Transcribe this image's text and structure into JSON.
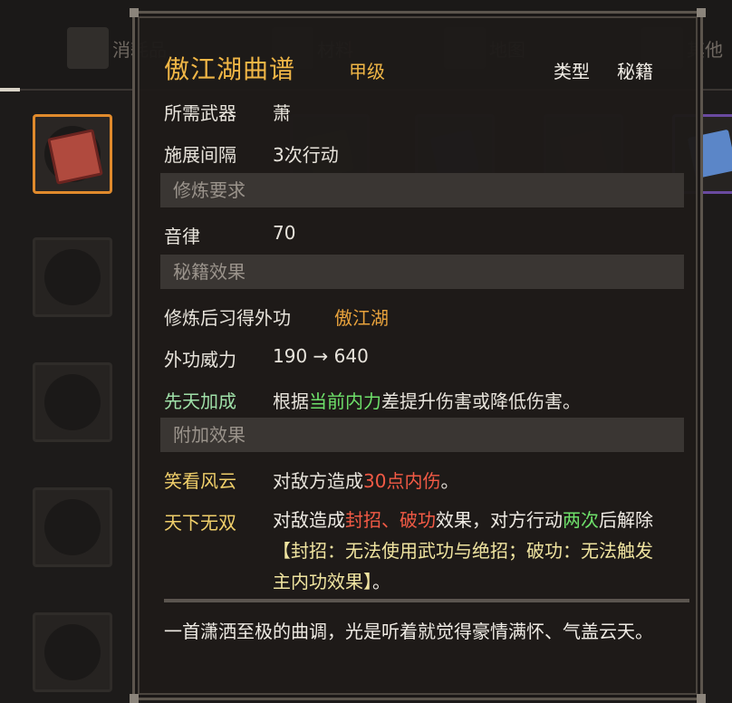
{
  "tabs": [
    {
      "label": "消耗品",
      "icon": "potion-icon"
    },
    {
      "label": "材料",
      "icon": "material-icon"
    },
    {
      "label": "地图",
      "icon": "map-icon"
    },
    {
      "label": "其他",
      "icon": "magnifier-icon"
    }
  ],
  "colors": {
    "accent": "#e8a23c",
    "green": "#6ee06a",
    "red": "#f25a45",
    "selected_border": "#e08a2c"
  },
  "tooltip": {
    "title": "傲江湖曲谱",
    "grade": "甲级",
    "type_label": "类型",
    "type_value": "秘籍",
    "weapon_label": "所需武器",
    "weapon_value": "萧",
    "interval_label": "施展间隔",
    "interval_value": "3次行动",
    "req_section": "修炼要求",
    "req_label": "音律",
    "req_value": "70",
    "effect_section": "秘籍效果",
    "learn_label": "修炼后习得外功",
    "learn_value": "傲江湖",
    "power_label": "外功威力",
    "power_value": "190 → 640",
    "innate_label": "先天加成",
    "innate_pre": "根据",
    "innate_highlight": "当前内力",
    "innate_post": "差提升伤害或降低伤害。",
    "extra_section": "附加效果",
    "laugh_label": "笑看风云",
    "laugh_pre": "对敌方造成",
    "laugh_highlight": "30点内伤",
    "laugh_post": "。",
    "peerless_label": "天下无双",
    "peerless_pre": "对敌造成",
    "peerless_red1": "封招",
    "peerless_sep": "、",
    "peerless_red2": "破功",
    "peerless_mid": "效果，对方行动",
    "peerless_green": "两次",
    "peerless_line2": "后解除",
    "peerless_bracket": "【封招：无法使用武功与绝招；破功：无法触发主内功效果】",
    "peerless_end": "。",
    "description": "一首潇洒至极的曲调，光是听着就觉得豪情满怀、气盖云天。"
  }
}
